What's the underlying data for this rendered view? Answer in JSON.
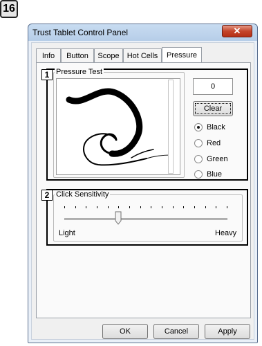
{
  "step_number": "16",
  "window": {
    "title": "Trust Tablet Control Panel",
    "close_glyph": "✕"
  },
  "tabs": [
    {
      "label": "Info"
    },
    {
      "label": "Button"
    },
    {
      "label": "Scope"
    },
    {
      "label": "Hot Cells"
    },
    {
      "label": "Pressure"
    }
  ],
  "active_tab": "Pressure",
  "callouts": [
    "1",
    "2"
  ],
  "pressure_test": {
    "label": "Pressure Test",
    "value": "0",
    "clear_label": "Clear",
    "colors": [
      {
        "label": "Black",
        "checked": true
      },
      {
        "label": "Red",
        "checked": false
      },
      {
        "label": "Green",
        "checked": false
      },
      {
        "label": "Blue",
        "checked": false
      }
    ]
  },
  "click_sensitivity": {
    "label": "Click Sensitivity",
    "min_label": "Light",
    "max_label": "Heavy",
    "tick_count": 16,
    "position_index": 5
  },
  "buttons": {
    "ok": "OK",
    "cancel": "Cancel",
    "apply": "Apply"
  },
  "colors": {
    "stroke": "#000000",
    "title_gradient_top": "#c8dcf1",
    "close_button": "#c4452b"
  }
}
